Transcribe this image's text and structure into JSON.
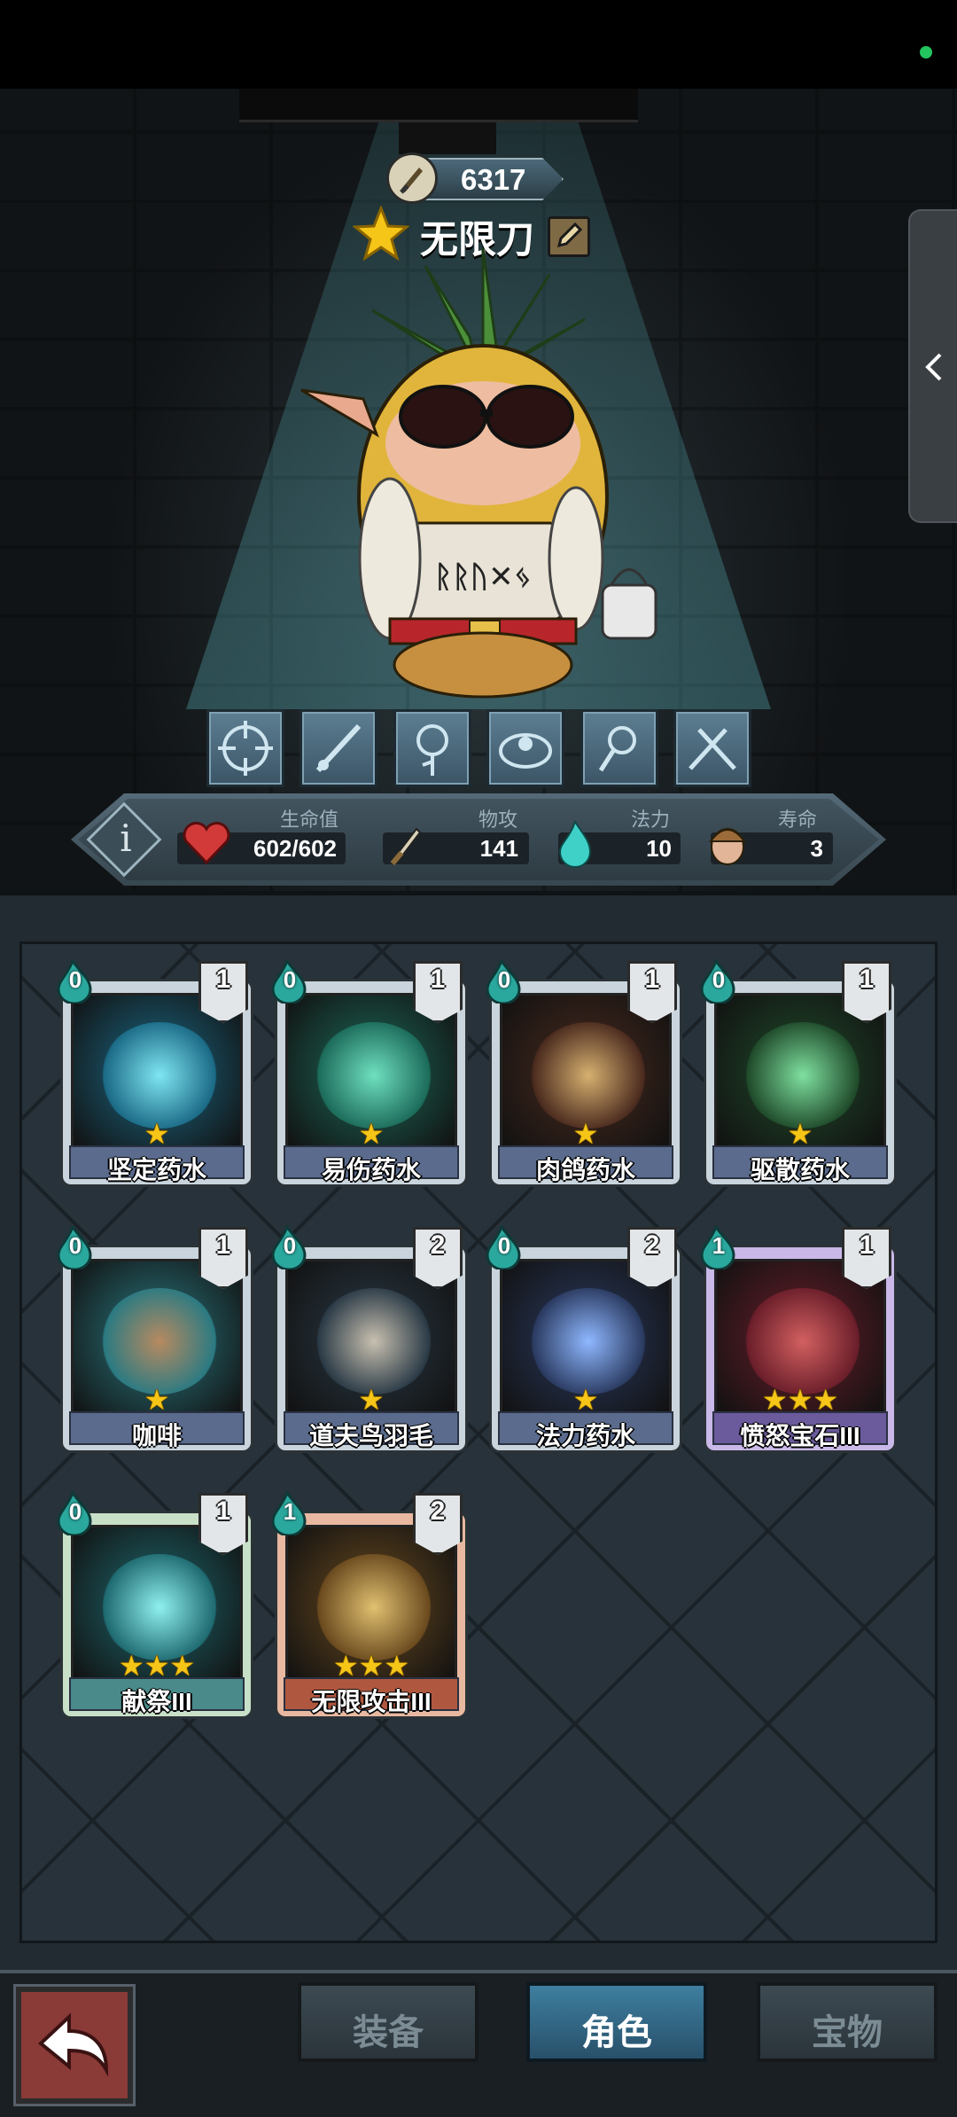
{
  "hero": {
    "power": "6317",
    "name": "无限刀",
    "skill_icons": [
      "target-skill-icon",
      "spear-skill-icon",
      "rose-skill-icon",
      "armor-skill-icon",
      "lantern-skill-icon",
      "crossed-guns-skill-icon"
    ]
  },
  "stats": {
    "hp": {
      "label": "生命值",
      "value": "602/602",
      "icon": "heart-icon"
    },
    "attack": {
      "label": "物攻",
      "value": "141",
      "icon": "sword-icon"
    },
    "mana": {
      "label": "法力",
      "value": "10",
      "icon": "flame-icon"
    },
    "lifespan": {
      "label": "寿命",
      "value": "3",
      "icon": "helmet-face-icon"
    }
  },
  "cards": [
    {
      "name": "坚定药水",
      "cost": "0",
      "count": "1",
      "stars": "★",
      "rarity": "common"
    },
    {
      "name": "易伤药水",
      "cost": "0",
      "count": "1",
      "stars": "★",
      "rarity": "common"
    },
    {
      "name": "肉鸽药水",
      "cost": "0",
      "count": "1",
      "stars": "★",
      "rarity": "common"
    },
    {
      "name": "驱散药水",
      "cost": "0",
      "count": "1",
      "stars": "★",
      "rarity": "common"
    },
    {
      "name": "咖啡",
      "cost": "0",
      "count": "1",
      "stars": "★",
      "rarity": "common"
    },
    {
      "name": "道夫鸟羽毛",
      "cost": "0",
      "count": "2",
      "stars": "★",
      "rarity": "common"
    },
    {
      "name": "法力药水",
      "cost": "0",
      "count": "2",
      "stars": "★",
      "rarity": "common"
    },
    {
      "name": "愤怒宝石III",
      "cost": "1",
      "count": "1",
      "stars": "★★★",
      "rarity": "epic"
    },
    {
      "name": "献祭III",
      "cost": "0",
      "count": "1",
      "stars": "★★★",
      "rarity": "uncommon"
    },
    {
      "name": "无限攻击III",
      "cost": "1",
      "count": "2",
      "stars": "★★★",
      "rarity": "rare"
    }
  ],
  "tabs": {
    "equipment": "装备",
    "character": "角色",
    "treasure": "宝物",
    "active": "character"
  },
  "colors": {
    "accent": "#3e7fa0",
    "star": "#f5c518",
    "common_plate": "#5a6b8d",
    "uncommon_plate": "#4a8a8a",
    "epic_plate": "#6b5a9c",
    "rare_plate": "#b0583f"
  }
}
